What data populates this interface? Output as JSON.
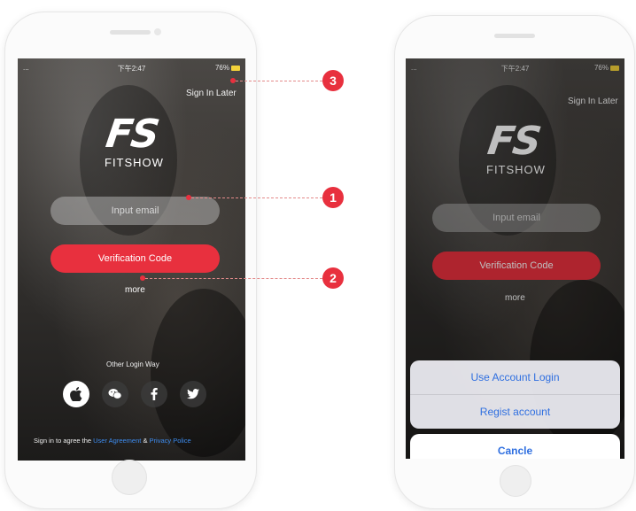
{
  "colors": {
    "accent": "#e8303e",
    "link": "#3d8cf0",
    "sheet_text": "#2f6fe0"
  },
  "phone1": {
    "status": {
      "left": "...",
      "time": "下午2:47",
      "right": "76%"
    },
    "sign_in_later": "Sign In Later",
    "logo": "FS",
    "brand": "FITSHOW",
    "email_placeholder": "Input email",
    "verification_button": "Verification Code",
    "more": "more",
    "other_login": "Other Login Way",
    "social_icons": [
      "apple-icon",
      "wechat-icon",
      "facebook-icon",
      "twitter-icon"
    ],
    "agree_prefix": "Sign in to agree the",
    "user_agreement": "User Agreement",
    "amp": "&",
    "privacy_policy": "Privacy Police"
  },
  "callouts": [
    "3",
    "1",
    "2"
  ],
  "phone2": {
    "status": {
      "left": "...",
      "time": "下午2:47",
      "right": "76%"
    },
    "sign_in_later": "Sign In Later",
    "logo": "FS",
    "brand": "FITSHOW",
    "email_placeholder": "Input email",
    "verification_button": "Verification Code",
    "more": "more",
    "sheet": {
      "items": [
        "Use Account Login",
        "Regist account"
      ],
      "cancel": "Cancle"
    }
  }
}
